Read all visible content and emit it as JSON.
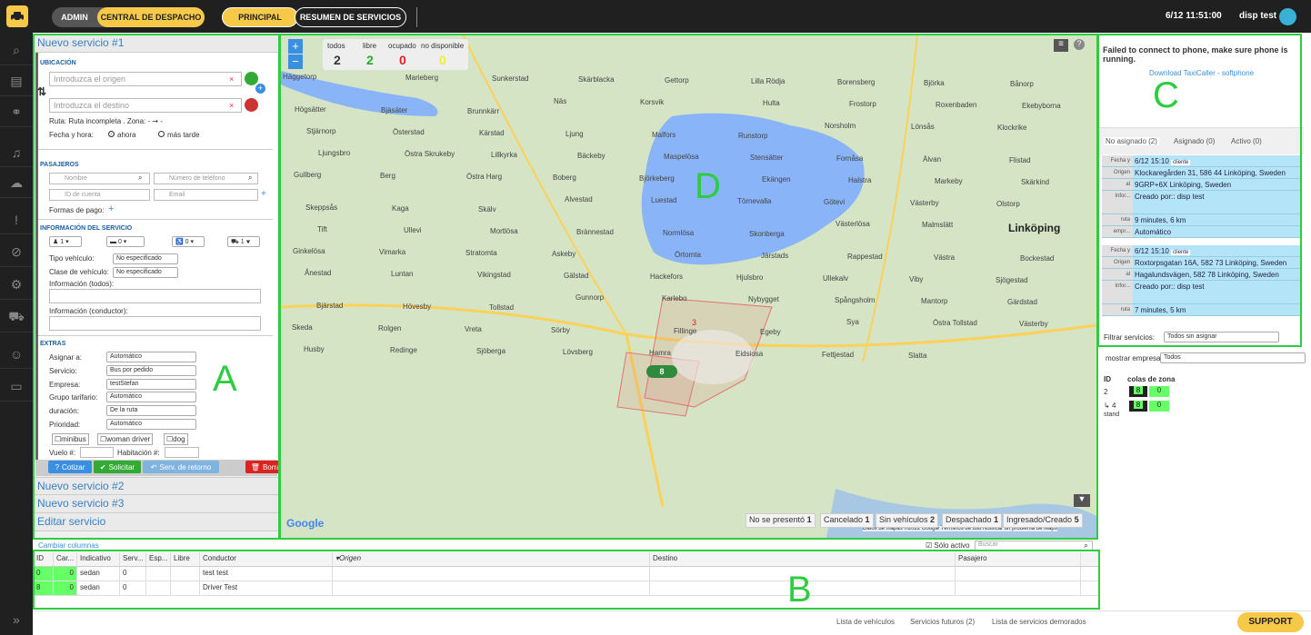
{
  "topbar": {
    "admin": "ADMIN",
    "central": "CENTRAL DE DESPACHO",
    "principal": "PRINCIPAL",
    "resumen": "RESUMEN DE SERVICIOS",
    "datetime": "6/12 11:51:00",
    "user": "disp test"
  },
  "form": {
    "title": "Nuevo servicio #1",
    "ubicacion": "UBICACIÓN",
    "origen_ph": "Introduzca el origen",
    "destino_ph": "Introduzca el destino",
    "ruta": "Ruta: Ruta incompleta . Zona: - ➞ -",
    "fecha": "Fecha y hora:",
    "ahora": "ahora",
    "mas_tarde": "más tarde",
    "pasajeros": "PASAJEROS",
    "nombre_ph": "Nombre",
    "telefono_ph": "Número de teléfono",
    "cuenta_ph": "ID de cuenta",
    "email_ph": "Email",
    "formas_pago": "Formas de pago:",
    "info_servicio": "INFORMACIÓN DEL SERVICIO",
    "pax": "1",
    "maletas": "0",
    "silla": "0",
    "vehiculos": "1",
    "tipo_vehiculo": "Tipo vehículo:",
    "tipo_vehiculo_val": "No especificado",
    "clase_vehiculo": "Clase de vehículo:",
    "clase_vehiculo_val": "No especificado",
    "info_todos": "Información (todos):",
    "info_conductor": "Información (conductor):",
    "extras": "EXTRAS",
    "asignar": "Asignar a:",
    "asignar_val": "Automático",
    "servicio": "Servicio:",
    "servicio_val": "Bus por pedido",
    "empresa": "Empresa:",
    "empresa_val": "testStefan",
    "grupo": "Grupo tarifario:",
    "grupo_val": "Automático",
    "duracion": "duración:",
    "duracion_val": "De la ruta",
    "prioridad": "Prioridad:",
    "prioridad_val": "Automático",
    "minibus": "minibus",
    "woman": "woman driver",
    "dog": "dog",
    "vuelo": "Vuelo #:",
    "habitacion": "Habitación #:",
    "cotizar": "Cotizar",
    "solicitar": "Solicitar",
    "retorno": "Serv. de retorno",
    "borrar": "Borrar",
    "nuevo2": "Nuevo servicio #2",
    "nuevo3": "Nuevo servicio #3",
    "editar": "Editar servicio"
  },
  "map": {
    "legend": {
      "todos_l": "todos",
      "libre_l": "libre",
      "ocupado_l": "ocupado",
      "nodisp_l": "no disponible",
      "todos": "2",
      "libre": "2",
      "ocupado": "0",
      "nodisp": "0"
    },
    "towns": [
      "Häggetorp",
      "Marieberg",
      "Sunkerstad",
      "Skärblacka",
      "Gettorp",
      "Lilla Rödja",
      "Borensberg",
      "Björka",
      "Bånorp",
      "Högsätter",
      "Bjäsäter",
      "Brunnkärr",
      "Näs",
      "Korsvik",
      "Hulta",
      "Frostorp",
      "Roxenbaden",
      "Ekebyborna",
      "Stjärnorp",
      "Österstad",
      "Kärstad",
      "Ljung",
      "Malfors",
      "Runstorp",
      "Norsholm",
      "Lönsås",
      "Klockrike",
      "Ljungsbro",
      "Östra Skrukeby",
      "Lillkyrka",
      "Bäckeby",
      "Maspelösa",
      "Stensätter",
      "Fornåsa",
      "Älvan",
      "Flistad",
      "Gullberg",
      "Berg",
      "Östra Harg",
      "Boberg",
      "Björkeberg",
      "Ekängen",
      "Halstra",
      "Markeby",
      "Skärkind",
      "Skeppsås",
      "Kaga",
      "Skälv",
      "Alvestad",
      "Luestad",
      "Törnevalla",
      "Götevi",
      "Västerby",
      "Olstorp",
      "Tift",
      "Ullevi",
      "Mortlösa",
      "Brännestad",
      "Normlösa",
      "Skonberga",
      "Västerlösa",
      "Malmslätt",
      "Linköping",
      "Ginkelösa",
      "Vimarka",
      "Stratomta",
      "Askeby",
      "Örtomta",
      "Järstads",
      "Rappestad",
      "Västra",
      "Bockestad",
      "Ånestad",
      "Luntan",
      "Vikingstad",
      "Gälstad",
      "Hackefors",
      "Hjulsbro",
      "Ullekalv",
      "Viby",
      "Sjögestad",
      "Bjärstad",
      "Hövesby",
      "Tollstad",
      "Gunnorp",
      "Karlebo",
      "Nybygget",
      "Spångsholm",
      "Mantorp",
      "Gärdstad",
      "Skeda",
      "Rolgen",
      "Vreta",
      "Sörby",
      "Fillinge",
      "Egeby",
      "Sya",
      "Östra Tollstad",
      "Västerby",
      "Husby",
      "Redinge",
      "Sjöberga",
      "Lövsberg",
      "Hamra",
      "Eidsiosa",
      "Fettjestad",
      "Slatta"
    ],
    "mapbtn_plus": "+",
    "mapbtn_minus": "−",
    "zone_label": "3",
    "car_label": "8",
    "letter": "D",
    "google": "Google",
    "attrib": "Datos de mapas ©2022 Google  Términos de uso  Notificar un problema de Maps"
  },
  "status": {
    "noshow": "No se presentó",
    "noshow_n": "1",
    "cancel": "Cancelado",
    "cancel_n": "1",
    "sinveh": "Sin vehículos",
    "sinveh_n": "2",
    "desp": "Despachado",
    "desp_n": "1",
    "ingr": "Ingresado/Creado",
    "ingr_n": "5"
  },
  "phone": {
    "msg": "Failed to connect to phone, make sure phone is running.",
    "link": "Download TaxiCaller - softphone"
  },
  "tabs": {
    "noasig": "No asignado (2)",
    "asig": "Asignado (0)",
    "activo": "Activo (0)"
  },
  "cards": [
    {
      "fecha": "6/12 15:10",
      "cliente": "cliente",
      "origen": "Klockaregården 31, 586 44 Linköping, Sweden",
      "al": "9GRP+6X Linköping, Sweden",
      "info": "Creado por:: disp test",
      "ruta": "9 minutes, 6 km",
      "empr": "Automático"
    },
    {
      "fecha": "6/12 15:10",
      "cliente": "cliente",
      "origen": "Roxtorpsgatan 16A, 582 73 Linköping, Sweden",
      "al": "Hagalundsvägen, 582 78 Linköping, Sweden",
      "info": "Creado por:: disp test",
      "ruta": "7 minutes, 5 km"
    }
  ],
  "card_keys": {
    "fecha": "Fecha y hora",
    "origen": "Origen",
    "al": "al",
    "info": "Infor...",
    "ruta": "ruta",
    "empr": "empr..."
  },
  "filtrar": "Filtrar servicios:",
  "filtrar_val": "Todos sin asignar",
  "empresa": {
    "label": "mostrar empresa:",
    "val": "Todos",
    "id": "ID",
    "colas": "colas de zona",
    "r1id": "2",
    "r2id": "4",
    "r2sub": "stand",
    "q8": "8",
    "q0": "0"
  },
  "grid": {
    "cambiar": "Cambiar columnas",
    "solo": "Sólo activo",
    "buscar_ph": "Buscar",
    "headers": [
      "ID",
      "Car...",
      "Indicativo",
      "Serv...",
      "Esp...",
      "Libre",
      "Conductor",
      "Origen",
      "Destino",
      "Pasajero"
    ],
    "rows": [
      [
        "0",
        "0",
        "sedan",
        "0",
        "",
        "",
        "test test",
        "",
        "",
        ""
      ],
      [
        "8",
        "0",
        "sedan",
        "0",
        "",
        "",
        "Driver Test",
        "",
        "",
        ""
      ]
    ]
  },
  "bottomtabs": {
    "lista": "Lista de vehículos",
    "futuros": "Servicios futuros (2)",
    "demorados": "Lista de servicios demorados"
  },
  "support": "SUPPORT",
  "letters": {
    "a": "A",
    "b": "B",
    "c": "C"
  }
}
